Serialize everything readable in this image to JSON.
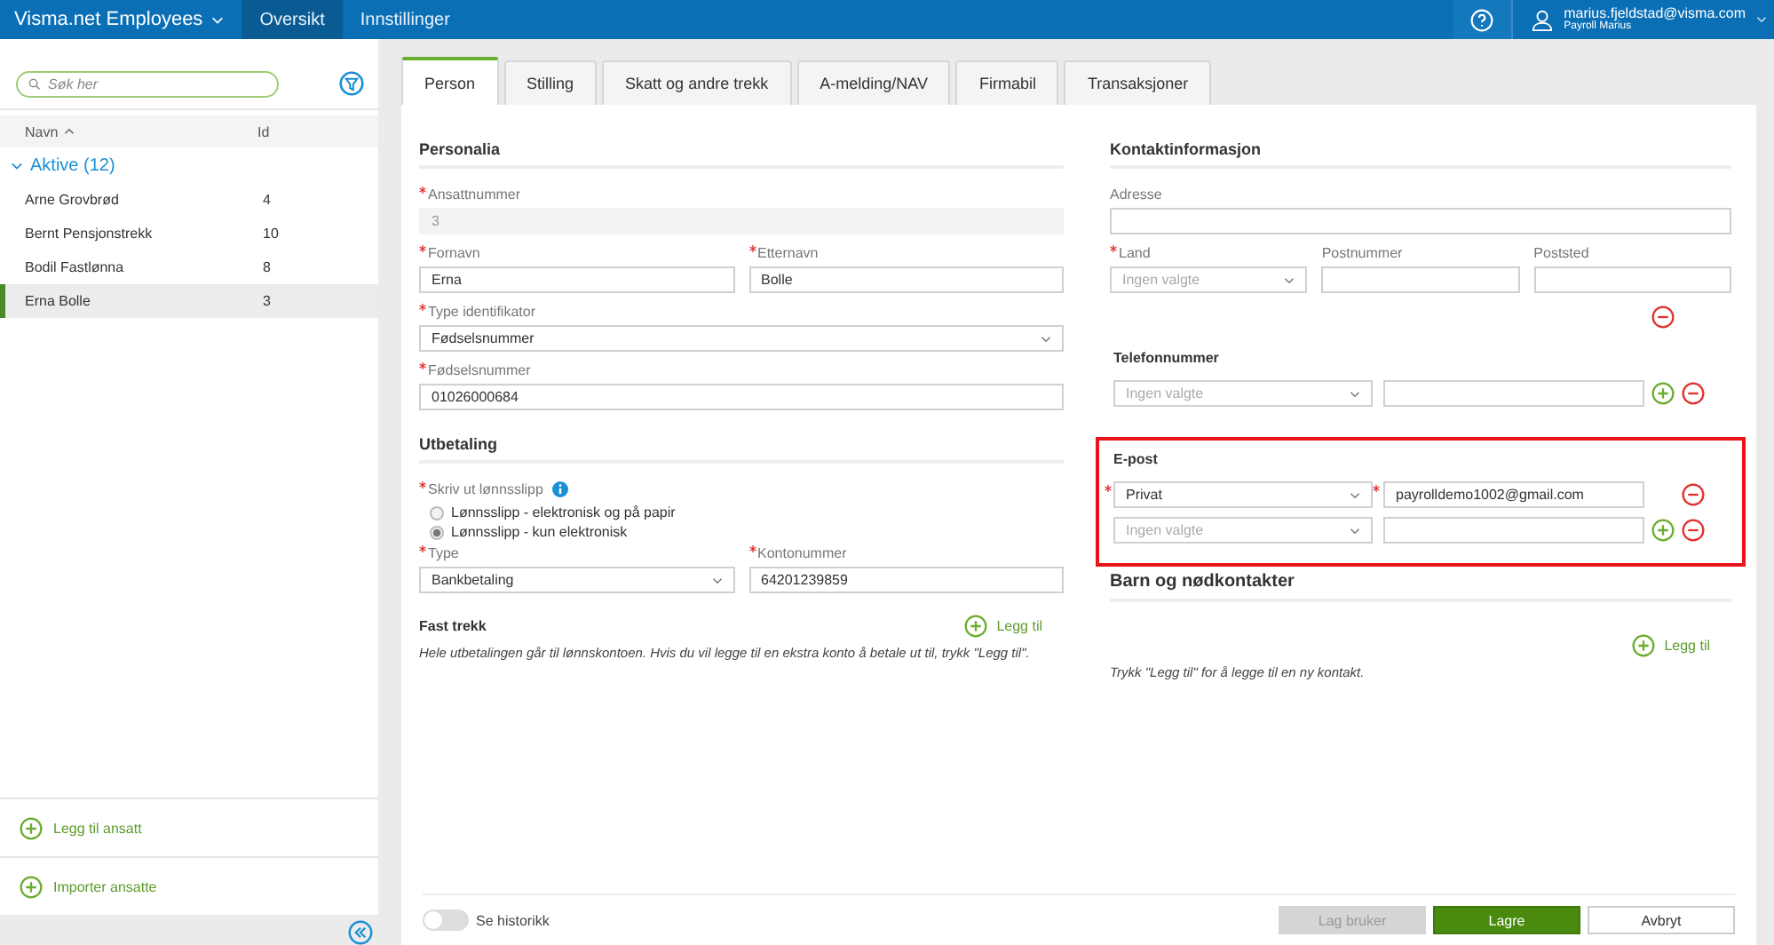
{
  "topbar": {
    "app_title": "Visma.net Employees",
    "nav": [
      {
        "label": "Oversikt",
        "selected": true
      },
      {
        "label": "Innstillinger",
        "selected": false
      }
    ],
    "user": {
      "email": "marius.fjeldstad@visma.com",
      "name": "Payroll Marius"
    }
  },
  "sidebar": {
    "search": {
      "placeholder": "Søk her"
    },
    "columns": [
      "Navn",
      "Id"
    ],
    "group": {
      "label": "Aktive (12)",
      "expanded": true
    },
    "employees": [
      {
        "name": "Arne Grovbrød",
        "id": "4",
        "selected": false
      },
      {
        "name": "Bernt Pensjonstrekk",
        "id": "10",
        "selected": false
      },
      {
        "name": "Bodil Fastlønna",
        "id": "8",
        "selected": false
      },
      {
        "name": "Erna Bolle",
        "id": "3",
        "selected": true
      }
    ],
    "actions": [
      "Legg til ansatt",
      "Importer ansatte"
    ]
  },
  "tabs": [
    {
      "label": "Person",
      "selected": true
    },
    {
      "label": "Stilling",
      "selected": false
    },
    {
      "label": "Skatt og andre trekk",
      "selected": false
    },
    {
      "label": "A-melding/NAV",
      "selected": false
    },
    {
      "label": "Firmabil",
      "selected": false
    },
    {
      "label": "Transaksjoner",
      "selected": false
    }
  ],
  "personalia": {
    "title": "Personalia",
    "rows": [
      [
        {
          "label": "Ansattnummer",
          "required": true,
          "kind": "readonly",
          "value": "3"
        }
      ],
      [
        {
          "label": "Fornavn",
          "required": true,
          "kind": "text",
          "value": "Erna"
        },
        {
          "label": "Etternavn",
          "required": true,
          "kind": "text",
          "value": "Bolle"
        }
      ],
      [
        {
          "label": "Type identifikator",
          "required": true,
          "kind": "select",
          "value": "Fødselsnummer"
        }
      ],
      [
        {
          "label": "Fødselsnummer",
          "required": true,
          "kind": "text",
          "value": "01026000684"
        }
      ]
    ]
  },
  "utbetaling": {
    "title": "Utbetaling",
    "payslip": {
      "label": "Skriv ut lønnsslipp",
      "required": true,
      "options": [
        {
          "label": "Lønnsslipp - elektronisk og på papir",
          "selected": false
        },
        {
          "label": "Lønnsslipp - kun elektronisk",
          "selected": true
        }
      ]
    },
    "rows": [
      [
        {
          "label": "Type",
          "required": true,
          "kind": "select",
          "value": "Bankbetaling"
        },
        {
          "label": "Kontonummer",
          "required": true,
          "kind": "text",
          "value": "64201239859"
        }
      ]
    ],
    "fast_trekk": {
      "title": "Fast trekk",
      "add": "Legg til",
      "note": "Hele utbetalingen går til lønnskontoen. Hvis du vil legge til en ekstra konto å betale ut til, trykk \"Legg til\"."
    }
  },
  "kontakt": {
    "title": "Kontaktinformasjon",
    "rows": [
      [
        {
          "label": "Adresse",
          "required": false,
          "kind": "text"
        }
      ],
      [
        {
          "label": "Land",
          "required": true,
          "kind": "select",
          "placeholder": "Ingen valgte"
        },
        {
          "label": "Postnummer",
          "required": false,
          "kind": "text"
        },
        {
          "label": "Poststed",
          "required": false,
          "kind": "text"
        }
      ]
    ],
    "groups": [
      {
        "title": "Telefonnummer",
        "highlighted": false,
        "rows": [
          {
            "required": false,
            "type_placeholder": "Ingen valgte",
            "add": true
          }
        ]
      },
      {
        "title": "E-post",
        "highlighted": true,
        "rows": [
          {
            "required": true,
            "type": "Privat",
            "value": "payrolldemo1002@gmail.com",
            "add": false
          },
          {
            "required": false,
            "type_placeholder": "Ingen valgte",
            "add": true
          }
        ]
      }
    ]
  },
  "barn": {
    "title": "Barn og nødkontakter",
    "add": "Legg til",
    "note": "Trykk \"Legg til\" for å legge til en ny kontakt."
  },
  "footer": {
    "history": {
      "label": "Se historikk",
      "on": false
    },
    "buttons": [
      {
        "label": "Lag bruker",
        "kind": "disabled"
      },
      {
        "label": "Lagre",
        "kind": "primary"
      },
      {
        "label": "Avbryt",
        "kind": "default"
      }
    ]
  }
}
